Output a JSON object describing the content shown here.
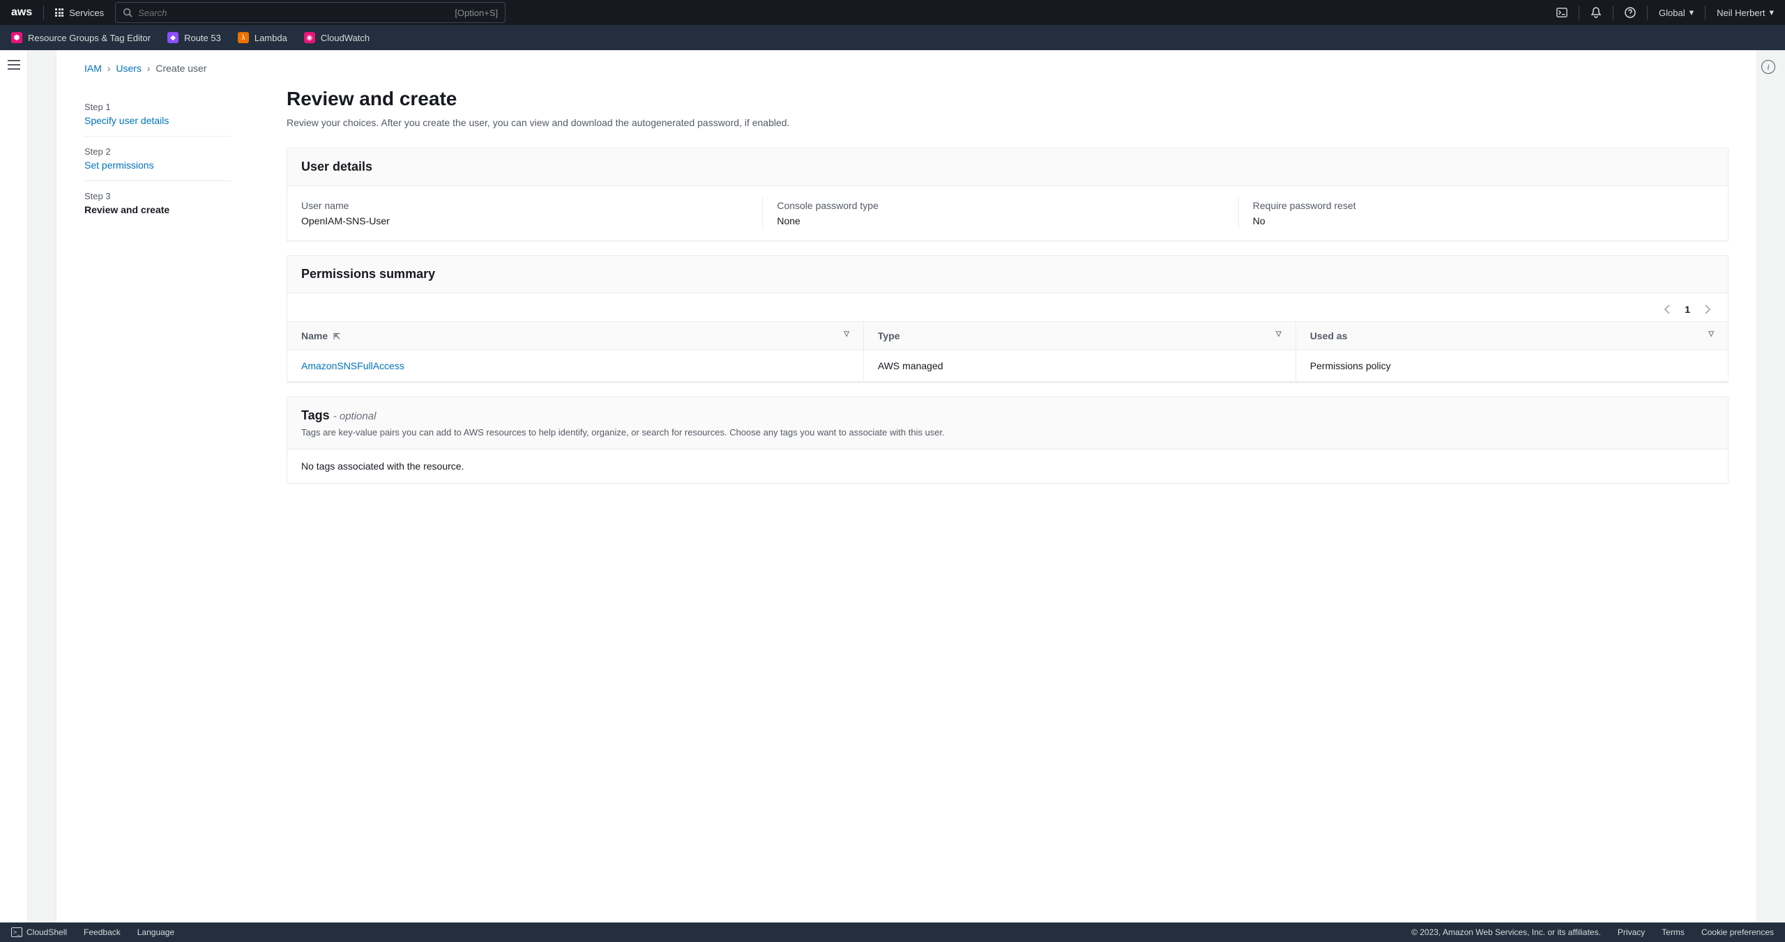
{
  "topnav": {
    "services_label": "Services",
    "search_placeholder": "Search",
    "search_hint": "[Option+S]",
    "region": "Global",
    "user": "Neil Herbert"
  },
  "favorites": [
    {
      "label": "Resource Groups & Tag Editor",
      "icon_class": "rg"
    },
    {
      "label": "Route 53",
      "icon_class": "r53"
    },
    {
      "label": "Lambda",
      "icon_class": "lambda"
    },
    {
      "label": "CloudWatch",
      "icon_class": "cw"
    }
  ],
  "breadcrumb": {
    "iam": "IAM",
    "users": "Users",
    "current": "Create user"
  },
  "steps": [
    {
      "label": "Step 1",
      "title": "Specify user details",
      "state": "link"
    },
    {
      "label": "Step 2",
      "title": "Set permissions",
      "state": "link"
    },
    {
      "label": "Step 3",
      "title": "Review and create",
      "state": "active"
    }
  ],
  "page": {
    "title": "Review and create",
    "subtitle": "Review your choices. After you create the user, you can view and download the autogenerated password, if enabled."
  },
  "user_details": {
    "panel_title": "User details",
    "username_label": "User name",
    "username_value": "OpenIAM-SNS-User",
    "password_type_label": "Console password type",
    "password_type_value": "None",
    "reset_label": "Require password reset",
    "reset_value": "No"
  },
  "permissions": {
    "panel_title": "Permissions summary",
    "page_num": "1",
    "columns": {
      "name": "Name",
      "type": "Type",
      "used_as": "Used as"
    },
    "rows": [
      {
        "name": "AmazonSNSFullAccess",
        "type": "AWS managed",
        "used_as": "Permissions policy"
      }
    ]
  },
  "tags": {
    "title": "Tags",
    "optional": "- optional",
    "desc": "Tags are key-value pairs you can add to AWS resources to help identify, organize, or search for resources. Choose any tags you want to associate with this user.",
    "empty": "No tags associated with the resource."
  },
  "footer": {
    "cloudshell": "CloudShell",
    "feedback": "Feedback",
    "language": "Language",
    "copyright": "© 2023, Amazon Web Services, Inc. or its affiliates.",
    "privacy": "Privacy",
    "terms": "Terms",
    "cookies": "Cookie preferences"
  }
}
